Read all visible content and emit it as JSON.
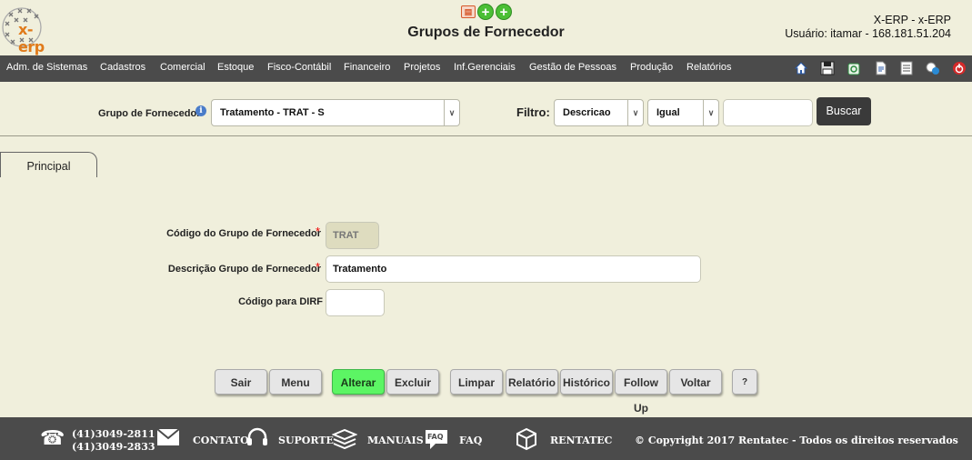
{
  "header": {
    "logo_text": "x-erp",
    "page_title": "Grupos de Fornecedor",
    "system_name": "X-ERP - x-ERP",
    "user_info": "Usuário: itamar - 168.181.51.204",
    "icons": [
      "pdf-icon",
      "add-icon",
      "add-icon"
    ]
  },
  "menu": {
    "items": [
      "Adm. de Sistemas",
      "Cadastros",
      "Comercial",
      "Estoque",
      "Fisco-Contábil",
      "Financeiro",
      "Projetos",
      "Inf.Gerenciais",
      "Gestão de Pessoas",
      "Produção",
      "Relatórios"
    ],
    "toolbar_icons": [
      "home-icon",
      "save-icon",
      "recycle-icon",
      "document-icon",
      "list-icon",
      "share-icon",
      "exit-icon"
    ]
  },
  "search": {
    "group_label": "Grupo de Fornecedor",
    "group_value": "Tratamento - TRAT - S",
    "filter_label": "Filtro:",
    "filter_field": "Descricao",
    "filter_operator": "Igual",
    "filter_value": "",
    "search_button": "Buscar"
  },
  "tabs": [
    {
      "label": "Principal"
    }
  ],
  "form": {
    "code_label": "Código do Grupo de Fornecedor",
    "code_value": "TRAT",
    "description_label": "Descrição Grupo de Fornecedor",
    "description_value": "Tratamento",
    "dirf_label": "Código para DIRF",
    "dirf_value": "",
    "required_mark": "*"
  },
  "actions": {
    "sair": "Sair",
    "menu": "Menu",
    "alterar": "Alterar",
    "excluir": "Excluir",
    "limpar": "Limpar",
    "relatorio": "Relatório",
    "historico": "Histórico",
    "follow_up": "Follow Up",
    "voltar": "Voltar",
    "help": "?"
  },
  "footer": {
    "phone1": "(41)3049-2811",
    "phone2": "(41)3049-2833",
    "contato": "CONTATO",
    "suporte": "SUPORTE",
    "manuais": "MANUAIS",
    "faq_badge": "FAQ",
    "faq": "FAQ",
    "rentatec": "RENTATEC",
    "copyright": "© Copyright 2017 Rentatec - Todos os direitos reservados"
  },
  "colors": {
    "background": "#f0efdc",
    "bar": "#4b4b4b",
    "accent_green": "#5cf564",
    "logo_orange": "#e07a1a"
  }
}
